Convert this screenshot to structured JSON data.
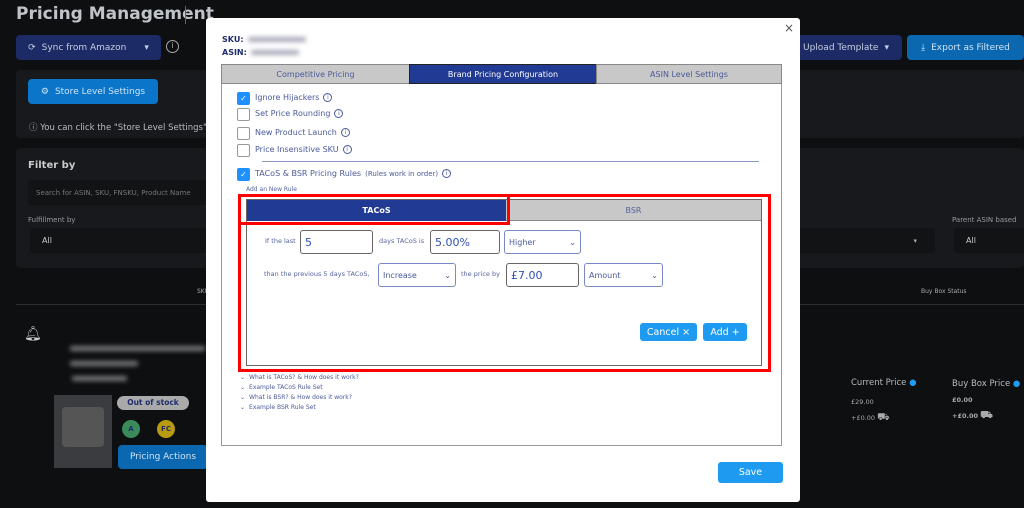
{
  "page": {
    "title": "Pricing Management",
    "sync_button": "Sync from Amazon",
    "upload_button": "Upload Template",
    "export_button": "Export as Filtered",
    "store_settings_button": "Store Level Settings",
    "info_text": "You can click the \"Store Level Settings\"",
    "filter_title": "Filter by",
    "search_placeholder": "Search for ASIN, SKU, FNSKU, Product Name",
    "fulfillment_label": "Fulfillment by",
    "fulfillment_value": "All",
    "parent_asin_label": "Parent ASIN based",
    "parent_asin_value": "All",
    "col_sku": "SKU",
    "col_buybox_status": "Buy Box Status"
  },
  "product": {
    "badge_stock": "Out of stock",
    "pill_a": "A",
    "pill_fc": "FC",
    "pricing_actions": "Pricing Actions",
    "current_price_label": "Current Price",
    "current_price": "£29.00",
    "current_shipping": "+£0.00",
    "buybox_price_label": "Buy Box Price",
    "buybox_price": "£0.00",
    "buybox_shipping": "+£0.00"
  },
  "modal": {
    "sku_label": "SKU:",
    "asin_label": "ASIN:",
    "tabs": [
      "Competitive Pricing",
      "Brand Pricing Configuration",
      "ASIN Level Settings"
    ],
    "active_tab": 1,
    "options": [
      {
        "label": "Ignore Hijackers",
        "checked": true
      },
      {
        "label": "Set Price Rounding",
        "checked": false
      },
      {
        "label": "New Product Launch",
        "checked": false
      },
      {
        "label": "Price Insensitive SKU",
        "checked": false
      }
    ],
    "rules_label": "TACoS & BSR Pricing Rules",
    "rules_note": "(Rules work in order)",
    "rules_checked": true,
    "add_rule": "Add an New Rule",
    "rule_tabs": [
      "TACoS",
      "BSR"
    ],
    "rule": {
      "if_last": "If the last",
      "days": "5",
      "days_tacos_is": "days TACoS is",
      "percent": "5.00%",
      "direction": "Higher",
      "than_prev": "than the previous 5 days TACoS,",
      "action": "Increase",
      "price_by": "the price by",
      "amount": "£7.00",
      "amount_type": "Amount"
    },
    "cancel": "Cancel ×",
    "add": "Add +",
    "links": [
      "What is TACoS? & How does it work?",
      "Example TACoS Rule Set",
      "What is BSR? & How does it work?",
      "Example BSR Rule Set"
    ],
    "save": "Save",
    "close": "×"
  },
  "colors": {
    "highlight": "#ff0000",
    "active_tab": "#213a93",
    "primary": "#1e9bf0"
  }
}
